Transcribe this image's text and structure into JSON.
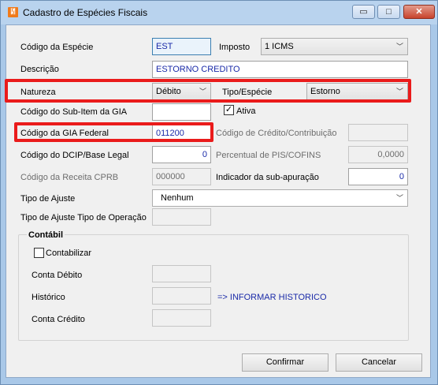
{
  "window": {
    "title": "Cadastro de Espécies Fiscais",
    "app_icon": "app-logo-icon",
    "controls": {
      "minimize": "▭",
      "maximize": "□",
      "close": "✕"
    }
  },
  "form": {
    "codigo_especie": {
      "label": "Código da Espécie",
      "value": "EST"
    },
    "imposto": {
      "label": "Imposto",
      "value": "1 ICMS"
    },
    "descricao": {
      "label": "Descrição",
      "value": "ESTORNO CREDITO"
    },
    "natureza": {
      "label": "Natureza",
      "value": "Débito"
    },
    "tipo_especie": {
      "label": "Tipo/Espécie",
      "value": "Estorno"
    },
    "sub_item_gia": {
      "label": "Código do Sub-Item da GIA",
      "value": ""
    },
    "ativa": {
      "label": "Ativa",
      "checked": true
    },
    "gia_federal": {
      "label": "Código da GIA Federal",
      "value": "011200"
    },
    "credito_contribuicao": {
      "label": "Código de Crédito/Contribuição",
      "value": ""
    },
    "dcip": {
      "label": "Código do DCIP/Base Legal",
      "value": "0"
    },
    "pis_cofins": {
      "label": "Percentual de PIS/COFINS",
      "value": "0,0000"
    },
    "receita_cprb": {
      "label": "Código da Receita CPRB",
      "value": "000000"
    },
    "sub_apuracao": {
      "label": "Indicador da sub-apuração",
      "value": "0"
    },
    "tipo_ajuste": {
      "label": "Tipo de Ajuste",
      "value": "Nenhum"
    },
    "tipo_ajuste_operacao": {
      "label": "Tipo de Ajuste Tipo de Operação",
      "value": ""
    }
  },
  "contabil": {
    "title": "Contábil",
    "contabilizar": {
      "label": "Contabilizar",
      "checked": false
    },
    "conta_debito": {
      "label": "Conta Débito",
      "value": ""
    },
    "historico": {
      "label": "Histórico",
      "value": "",
      "link": "=> INFORMAR HISTORICO"
    },
    "conta_credito": {
      "label": "Conta Crédito",
      "value": ""
    }
  },
  "buttons": {
    "confirmar": "Confirmar",
    "cancelar": "Cancelar"
  },
  "colors": {
    "highlight": "#ea1b1b",
    "value_text": "#1a2aa8",
    "titlebar": "#b9d3ee"
  }
}
